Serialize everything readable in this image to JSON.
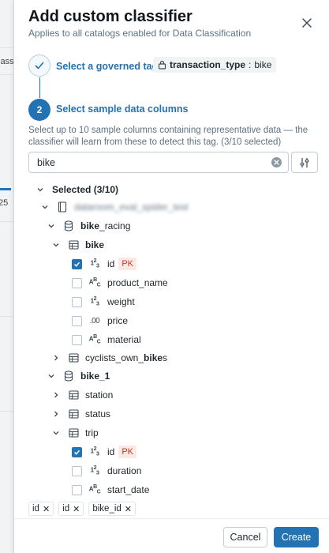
{
  "background": {
    "fragment_1": "lass",
    "fragment_2": "25"
  },
  "header": {
    "title": "Add custom classifier",
    "subtitle": "Applies to all catalogs enabled for Data Classification"
  },
  "step1": {
    "label": "Select a governed tag",
    "tag_key": "transaction_type",
    "tag_sep": ":",
    "tag_value": "bike"
  },
  "step2": {
    "number": "2",
    "label": "Select sample data columns",
    "helper": "Select up to 10 sample columns containing representative data — the classifier will learn from these to detect this tag. (3/10 selected)"
  },
  "search": {
    "value": "bike"
  },
  "tree": {
    "selected_label": "Selected (3/10)",
    "catalog_name": "dataroom_eval_spider_test",
    "schema1": {
      "prefix": "bike",
      "suffix": "_racing"
    },
    "table_bike": "bike",
    "bike_columns": [
      {
        "type": "123",
        "name": "id",
        "pk": "PK",
        "checked": true
      },
      {
        "type": "ABC",
        "name": "product_name",
        "checked": false
      },
      {
        "type": "123",
        "name": "weight",
        "checked": false
      },
      {
        "type": ".00",
        "name": "price",
        "checked": false
      },
      {
        "type": "ABC",
        "name": "material",
        "checked": false
      }
    ],
    "table_cyclists": {
      "prefix": "cyclists_own_",
      "bold": "bike",
      "suffix": "s"
    },
    "schema2": "bike_1",
    "table_station": "station",
    "table_status": "status",
    "table_trip": "trip",
    "trip_columns": [
      {
        "type": "123",
        "name": "id",
        "pk": "PK",
        "checked": true
      },
      {
        "type": "123",
        "name": "duration",
        "checked": false
      },
      {
        "type": "ABC",
        "name": "start_date",
        "checked": false
      }
    ]
  },
  "selected_chips": [
    "id",
    "id",
    "bike_id"
  ],
  "footer": {
    "cancel": "Cancel",
    "create": "Create"
  },
  "colors": {
    "accent": "#2272b4",
    "pk_bg": "#fbe9e6",
    "pk_text": "#c23a24",
    "tag_bg": "#eef5f4"
  }
}
